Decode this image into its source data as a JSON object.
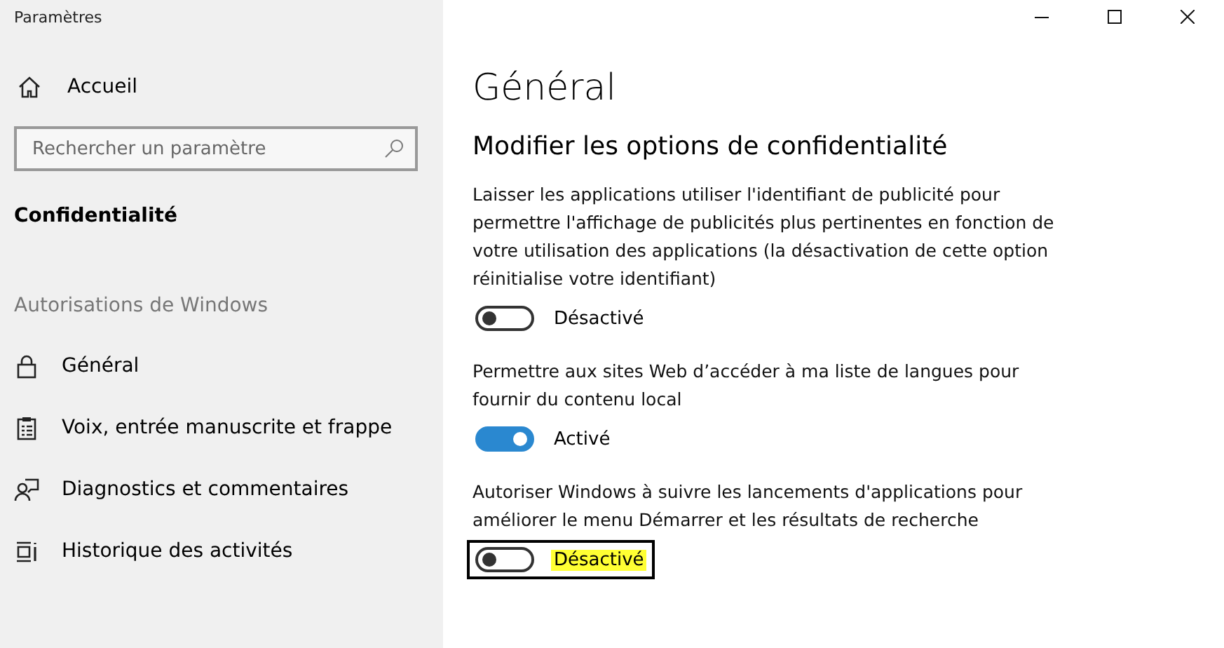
{
  "window": {
    "title": "Paramètres"
  },
  "sidebar": {
    "home": "Accueil",
    "search": {
      "placeholder": "Rechercher un paramètre"
    },
    "section": "Confidentialité",
    "group": "Autorisations de Windows",
    "items": [
      {
        "label": "Général"
      },
      {
        "label": "Voix, entrée manuscrite et frappe"
      },
      {
        "label": "Diagnostics et commentaires"
      },
      {
        "label": "Historique des activités"
      }
    ]
  },
  "main": {
    "title": "Général",
    "subtitle": "Modifier les options de confidentialité",
    "settings": [
      {
        "description": "Laisser les applications utiliser l'identifiant de publicité pour permettre l'affichage de publicités plus pertinentes en fonction de votre utilisation des applications (la désactivation de cette option réinitialise votre identifiant)",
        "on": false,
        "state_label": "Désactivé",
        "focused": false,
        "highlighted": false
      },
      {
        "description": "Permettre aux sites Web d’accéder à ma liste de langues pour fournir du contenu local",
        "on": true,
        "state_label": "Activé",
        "focused": false,
        "highlighted": false
      },
      {
        "description": "Autoriser Windows à suivre les lancements d'applications pour améliorer le menu Démarrer et les résultats de recherche",
        "on": false,
        "state_label": "Désactivé",
        "focused": true,
        "highlighted": true
      }
    ]
  }
}
